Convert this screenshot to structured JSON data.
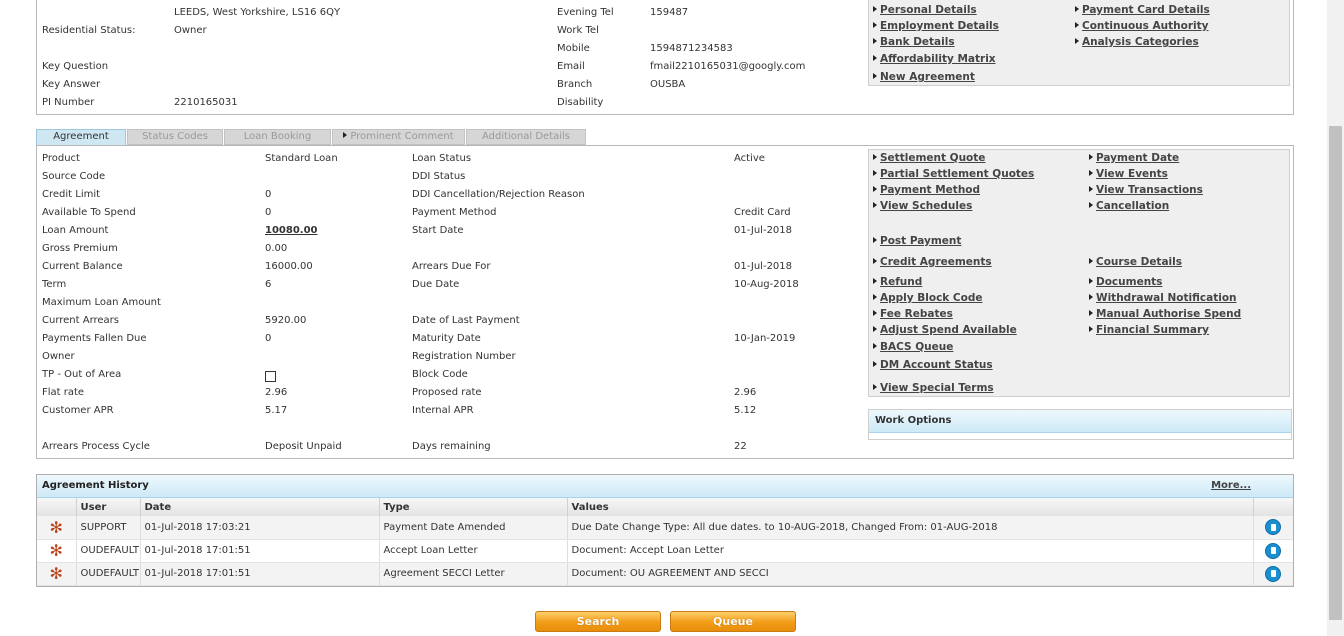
{
  "customer": {
    "address_line": "LEEDS, West Yorkshire, LS16 6QY",
    "residential_status_label": "Residential Status:",
    "residential_status_value": "Owner",
    "key_question_label": "Key Question",
    "key_answer_label": "Key Answer",
    "pi_number_label": "PI Number",
    "pi_number_value": "2210165031",
    "evening_tel_label": "Evening Tel",
    "evening_tel_value": "159487",
    "work_tel_label": "Work Tel",
    "mobile_label": "Mobile",
    "mobile_value": "1594871234583",
    "email_label": "Email",
    "email_value": "fmail2210165031@googly.com",
    "branch_label": "Branch",
    "branch_value": "OUSBA",
    "disability_label": "Disability"
  },
  "top_links": {
    "col1": [
      "Personal Details",
      "Employment Details",
      "Bank Details",
      "Affordability Matrix",
      "New Agreement"
    ],
    "col2": [
      "Payment Card Details",
      "Continuous Authority",
      "Analysis Categories"
    ]
  },
  "tabs": [
    "Agreement",
    "Status Codes",
    "Loan Booking",
    "Prominent Comment",
    "Additional Details"
  ],
  "agreement": {
    "left_labels": [
      "Product",
      "Source Code",
      "Credit Limit",
      "Available To Spend",
      "Loan Amount",
      "Gross Premium",
      "Current Balance",
      "Term",
      "Maximum Loan Amount",
      "Current Arrears",
      "Payments Fallen Due",
      "Owner",
      "TP - Out of Area",
      "Flat rate",
      "Customer APR",
      "Arrears Process Cycle"
    ],
    "left_values": [
      "Standard Loan",
      "",
      "0",
      "0",
      "10080.00",
      "0.00",
      "16000.00",
      "6",
      "",
      "5920.00",
      "0",
      "",
      "",
      "2.96",
      "5.17",
      "Deposit Unpaid"
    ],
    "right_labels": [
      "Loan Status",
      "DDI Status",
      "DDI Cancellation/Rejection Reason",
      "Payment Method",
      "Start Date",
      "",
      "Arrears Due For",
      "Due Date",
      "",
      "Date of Last Payment",
      "Maturity Date",
      "Registration Number",
      "Block Code",
      "Proposed rate",
      "Internal APR",
      "Days remaining"
    ],
    "right_values": [
      "Active",
      "",
      "",
      "Credit Card",
      "01-Jul-2018",
      "",
      "01-Jul-2018",
      "10-Aug-2018",
      "",
      "",
      "10-Jan-2019",
      "",
      "",
      "2.96",
      "5.12",
      "22"
    ]
  },
  "actions": {
    "settlement_quote": "Settlement Quote",
    "payment_date": "Payment Date",
    "partial_settlement_quotes": "Partial Settlement Quotes",
    "view_events": "View Events",
    "payment_method": "Payment Method",
    "view_transactions": "View Transactions",
    "view_schedules": "View Schedules",
    "cancellation": "Cancellation",
    "post_payment": "Post Payment",
    "credit_agreements": "Credit Agreements",
    "course_details": "Course Details",
    "refund": "Refund",
    "documents": "Documents",
    "apply_block_code": "Apply Block Code",
    "withdrawal_notification": "Withdrawal Notification",
    "fee_rebates": "Fee Rebates",
    "manual_authorise_spend": "Manual Authorise Spend",
    "adjust_spend_available": "Adjust Spend Available",
    "financial_summary": "Financial Summary",
    "bacs_queue": "BACS Queue",
    "dm_account_status": "DM Account Status",
    "view_special_terms": "View Special Terms"
  },
  "work_options": {
    "title": "Work Options"
  },
  "history": {
    "title": "Agreement History",
    "more": "More...",
    "columns": [
      "User",
      "Date",
      "Type",
      "Values"
    ],
    "rows": [
      {
        "user": "SUPPORT",
        "date": "01-Jul-2018 17:03:21",
        "type": "Payment Date Amended",
        "values": "Due Date Change Type: All due dates. to 10-AUG-2018, Changed From: 01-AUG-2018"
      },
      {
        "user": "OUDEFAULT",
        "date": "01-Jul-2018 17:01:51",
        "type": "Accept Loan Letter",
        "values": "Document: Accept Loan Letter"
      },
      {
        "user": "OUDEFAULT",
        "date": "01-Jul-2018 17:01:51",
        "type": "Agreement SECCI Letter",
        "values": "Document: OU AGREEMENT AND SECCI"
      }
    ]
  },
  "buttons": {
    "search": "Search",
    "queue": "Queue"
  }
}
